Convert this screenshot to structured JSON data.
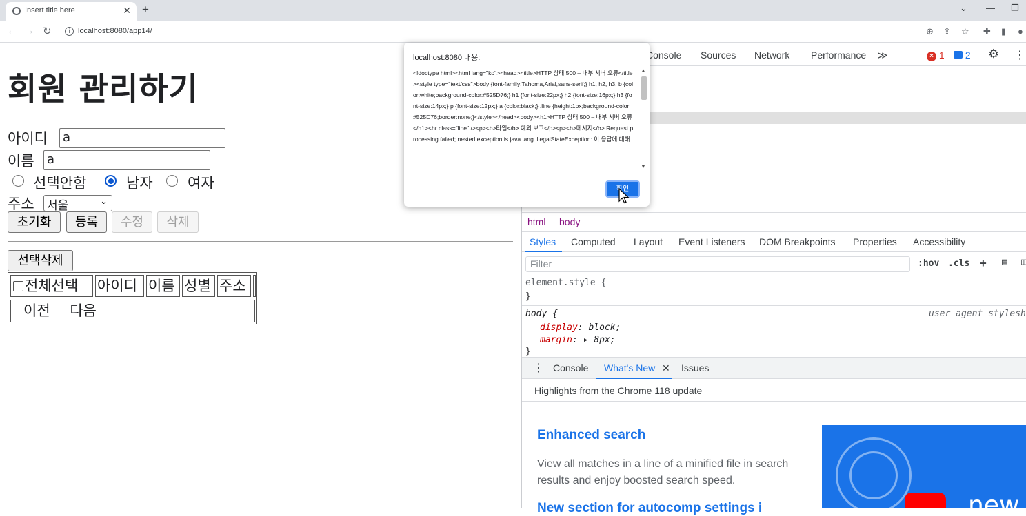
{
  "browser": {
    "tab_title": "Insert title here",
    "tab_close": "✕",
    "new_tab": "+",
    "url": "localhost:8080/app14/",
    "win_min": "—",
    "win_restore": "❐",
    "win_chevron": "⌄"
  },
  "page": {
    "title": "회원 관리하기",
    "id_label": "아이디",
    "id_value": "a",
    "name_label": "이름",
    "name_value": "a",
    "gender_options": [
      "선택안함",
      "남자",
      "여자"
    ],
    "gender_selected": "남자",
    "address_label": "주소",
    "address_value": "서울",
    "buttons": {
      "reset": "초기화",
      "register": "등록",
      "update": "수정",
      "delete": "삭제",
      "delete_selected": "선택삭제"
    },
    "table_headers": [
      "전체선택",
      "아이디",
      "이름",
      "성별",
      "주소"
    ],
    "pager": {
      "prev": "이전",
      "next": "다음"
    }
  },
  "dialog": {
    "title": "localhost:8080 내용:",
    "message": "<!doctype html><html lang=\"ko\"><head><title>HTTP 상태 500 – 내부 서버 오류</title><style type=\"text/css\">body {font-family:Tahoma,Arial,sans-serif;} h1, h2, h3, b {color:white;background-color:#525D76;} h1 {font-size:22px;} h2 {font-size:16px;} h3 {font-size:14px;} p {font-size:12px;} a {color:black;} .line {height:1px;background-color:#525D76;border:none;}</style></head><body><h1>HTTP 상태 500 – 내부 서버 오류</h1><hr class=\"line\" /><p><b>타입</b> 예외 보고</p><p><b>메시지</b> Request processing failed; nested exception is java.lang.IllegalStateException: 이 응답에 대해",
    "ok": "확인"
  },
  "devtools": {
    "tabs": [
      "Console",
      "Sources",
      "Network",
      "Performance"
    ],
    "more_tabs": "≫",
    "errors": "1",
    "messages": "2",
    "breadcrumbs": [
      "html",
      "body"
    ],
    "styles_tabs": [
      "Styles",
      "Computed",
      "Layout",
      "Event Listeners",
      "DOM Breakpoints",
      "Properties",
      "Accessibility"
    ],
    "filter_placeholder": "Filter",
    "hov": ":hov",
    "cls": ".cls",
    "element_style": "element.style {",
    "close_brace": "}",
    "body_rule": "body {",
    "user_agent": "user agent stylesh",
    "display_prop": "display",
    "display_val": "block;",
    "margin_prop": "margin",
    "margin_val": "8px;",
    "drawer_tabs": [
      "Console",
      "What's New",
      "Issues"
    ],
    "highlights": "Highlights from the Chrome 118 update",
    "card_title": "Enhanced search",
    "card_body": "View all matches in a line of a minified file in search results and enjoy boosted search speed.",
    "card_title2": "New section for autocomp settings i",
    "img_text": "new"
  }
}
